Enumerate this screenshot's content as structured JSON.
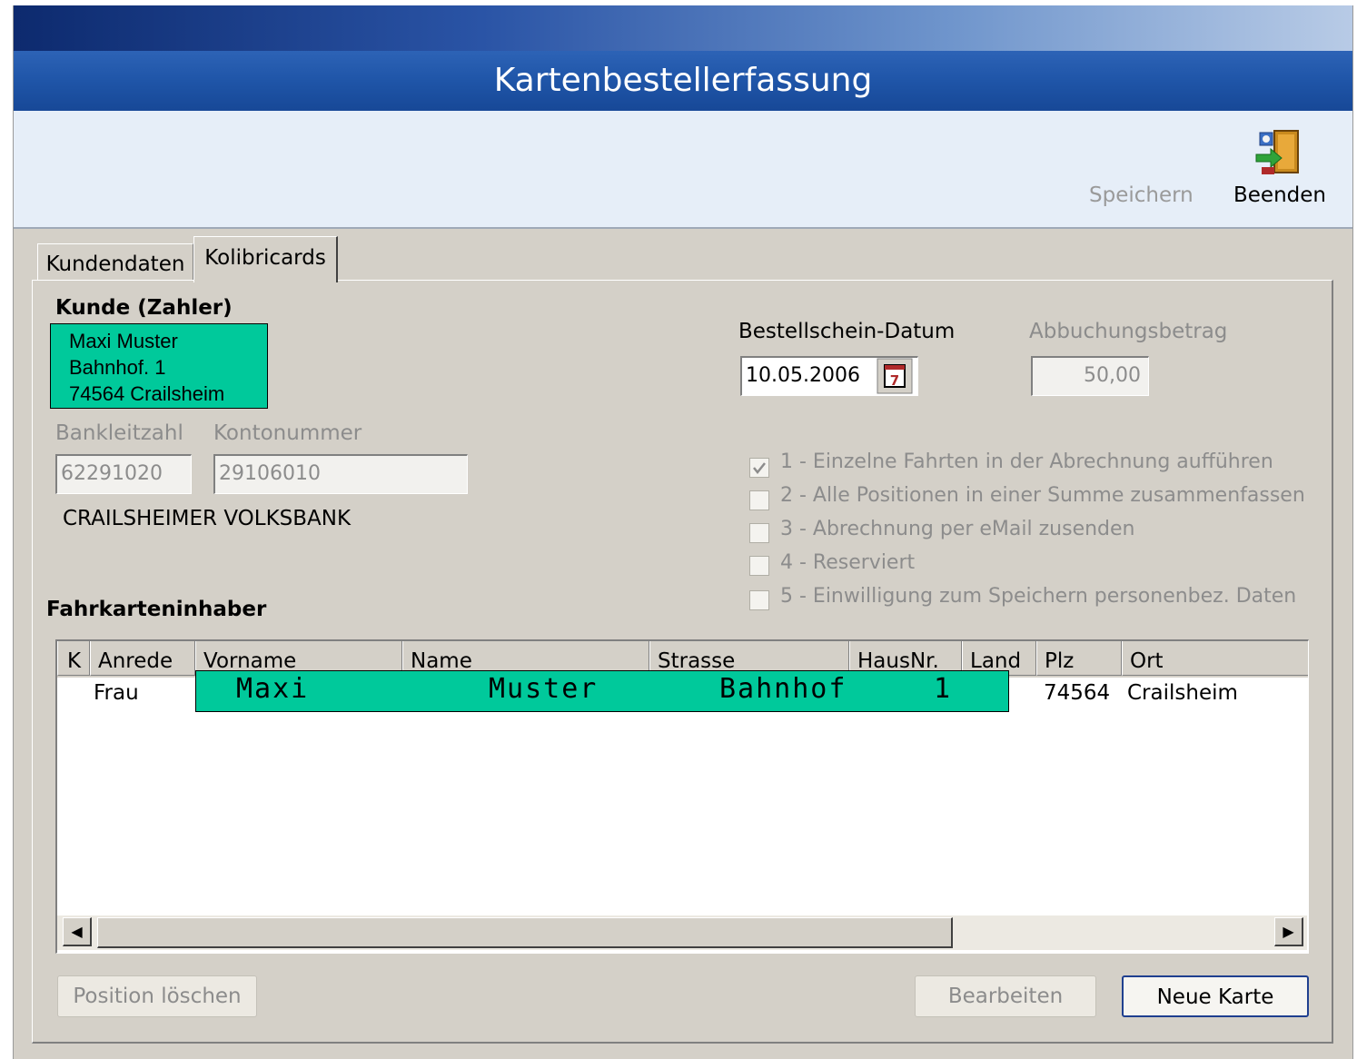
{
  "window": {
    "title": "Kartenbestellerfassung"
  },
  "toolbar": {
    "save_label": "Speichern",
    "exit_label": "Beenden",
    "exit_icon": "exit-door-icon"
  },
  "tabs": [
    {
      "label": "Kundendaten"
    },
    {
      "label": "Kolibricards"
    }
  ],
  "customer": {
    "section_title": "Kunde (Zahler)",
    "name": "Maxi Muster",
    "street": "Bahnhof. 1",
    "city": "74564 Crailsheim",
    "bank_code_label": "Bankleitzahl",
    "bank_code": "62291020",
    "account_label": "Kontonummer",
    "account": "29106010",
    "bank_name": "CRAILSHEIMER VOLKSBANK"
  },
  "order": {
    "date_label": "Bestellschein-Datum",
    "date": "10.05.2006",
    "amount_label": "Abbuchungsbetrag",
    "amount": "50,00"
  },
  "options": [
    {
      "label": "1 - Einzelne Fahrten in der Abrechnung aufführen",
      "checked": true
    },
    {
      "label": "2 - Alle Positionen in einer Summe zusammenfassen",
      "checked": false
    },
    {
      "label": "3 - Abrechnung per eMail zusenden",
      "checked": false
    },
    {
      "label": "4 - Reserviert",
      "checked": false
    },
    {
      "label": "5 - Einwilligung zum Speichern personenbez. Daten",
      "checked": false
    }
  ],
  "holders": {
    "section_title": "Fahrkarteninhaber",
    "columns": [
      "K",
      "Anrede",
      "Vorname",
      "Name",
      "Strasse",
      "HausNr.",
      "Land",
      "Plz",
      "Ort"
    ],
    "rows": [
      {
        "anrede": "Frau",
        "vorname": "Maxi",
        "name": "Muster",
        "strasse": "Bahnhof",
        "hausnr": "1",
        "plz": "74564",
        "ort": "Crailsheim"
      }
    ]
  },
  "buttons": {
    "delete": "Position löschen",
    "edit": "Bearbeiten",
    "new": "Neue Karte"
  },
  "colors": {
    "highlight": "#00c99b",
    "title_bar": "#1f55a8"
  }
}
